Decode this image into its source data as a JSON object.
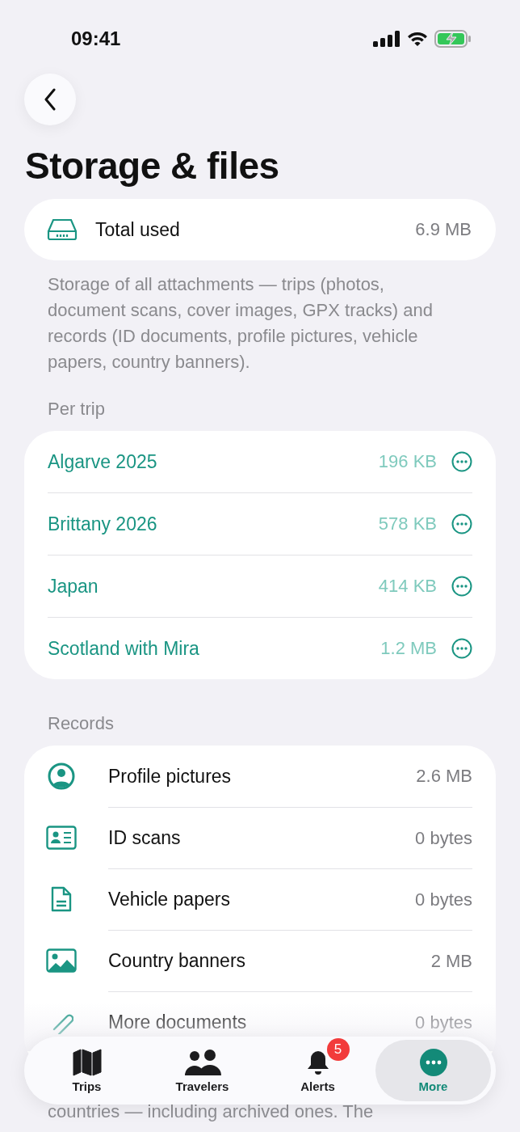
{
  "status_bar": {
    "time": "09:41"
  },
  "header": {
    "title": "Storage & files"
  },
  "total": {
    "label": "Total used",
    "value": "6.9 MB"
  },
  "description": "Storage of all attachments — trips (photos, document scans, cover images, GPX tracks) and records (ID documents, profile pictures, vehicle papers, country banners).",
  "per_trip": {
    "heading": "Per trip",
    "items": [
      {
        "name": "Algarve 2025",
        "size": "196 KB"
      },
      {
        "name": "Brittany 2026",
        "size": "578 KB"
      },
      {
        "name": "Japan",
        "size": "414 KB"
      },
      {
        "name": "Scotland with Mira",
        "size": "1.2 MB"
      }
    ]
  },
  "records": {
    "heading": "Records",
    "items": [
      {
        "kind": "profile",
        "name": "Profile pictures",
        "size": "2.6 MB"
      },
      {
        "kind": "id",
        "name": "ID scans",
        "size": "0 bytes"
      },
      {
        "kind": "document",
        "name": "Vehicle papers",
        "size": "0 bytes"
      },
      {
        "kind": "image",
        "name": "Country banners",
        "size": "2 MB"
      },
      {
        "kind": "paperclip",
        "name": "More documents",
        "size": "0 bytes"
      }
    ]
  },
  "footnote": "countries — including archived ones. The",
  "tab_bar": [
    {
      "kind": "map",
      "label": "Trips",
      "selected": false
    },
    {
      "kind": "people",
      "label": "Travelers",
      "selected": false
    },
    {
      "kind": "bell",
      "label": "Alerts",
      "selected": false,
      "badge": "5"
    },
    {
      "kind": "more",
      "label": "More",
      "selected": true
    }
  ]
}
